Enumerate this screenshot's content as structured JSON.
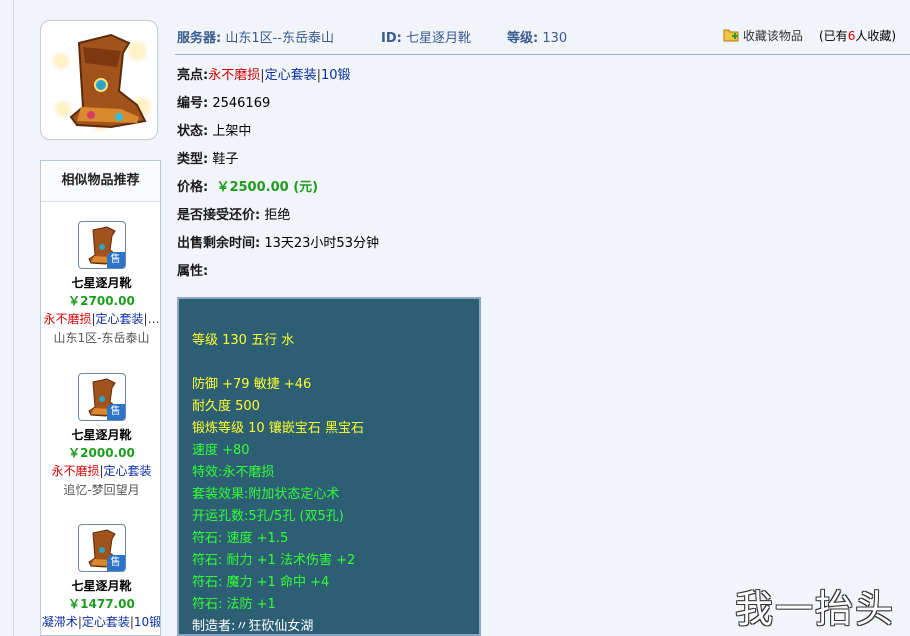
{
  "header": {
    "server_label": "服务器:",
    "server_value": "山东1区--东岳泰山",
    "id_label": "ID:",
    "id_value": "七星逐月靴",
    "level_label": "等级:",
    "level_value": "130",
    "favorite_label": "收藏该物品",
    "fav_pre": "(已有",
    "fav_num": "6",
    "fav_post": "人收藏)"
  },
  "detail": {
    "highlight_label": "亮点:",
    "highlight_tags": [
      "永不磨损",
      "定心套装",
      "10锻"
    ],
    "number_label": "编号:",
    "number_value": "2546169",
    "status_label": "状态:",
    "status_value": "上架中",
    "type_label": "类型:",
    "type_value": "鞋子",
    "price_label": "价格:",
    "price_value": "￥2500.00 (元)",
    "bargain_label": "是否接受还价:",
    "bargain_value": "拒绝",
    "remaining_label": "出售剩余时间:",
    "remaining_value": "13天23小时53分钟",
    "attr_label": "属性:"
  },
  "attributes": [
    {
      "text": "等级 130 五行 水",
      "color": "yellow"
    },
    {
      "text": "",
      "color": "yellow"
    },
    {
      "text": "防御 +79 敏捷 +46",
      "color": "yellow"
    },
    {
      "text": "耐久度 500",
      "color": "yellow"
    },
    {
      "text": "锻炼等级 10 镶嵌宝石 黑宝石",
      "color": "yellow"
    },
    {
      "text": "速度 +80",
      "color": "green"
    },
    {
      "text": "特效:永不磨损",
      "color": "green"
    },
    {
      "text": "套装效果:附加状态定心术",
      "color": "green"
    },
    {
      "text": "开运孔数:5孔/5孔 (双5孔)",
      "color": "green"
    },
    {
      "text": "符石: 速度 +1.5",
      "color": "green"
    },
    {
      "text": "符石: 耐力 +1 法术伤害 +2",
      "color": "green"
    },
    {
      "text": "符石: 魔力 +1 命中 +4",
      "color": "green"
    },
    {
      "text": "符石: 法防 +1",
      "color": "green"
    },
    {
      "text": "制造者:〃狂砍仙女湖",
      "color": "white"
    }
  ],
  "similar": {
    "title": "相似物品推荐",
    "sale_tag": "售",
    "items": [
      {
        "name": "七星逐月靴",
        "price": "￥2700.00",
        "tags": [
          "永不磨损",
          "定心套装",
          "…"
        ],
        "server": "山东1区-东岳泰山"
      },
      {
        "name": "七星逐月靴",
        "price": "￥2000.00",
        "tags": [
          "永不磨损",
          "定心套装"
        ],
        "server": "追忆-梦回望月"
      },
      {
        "name": "七星逐月靴",
        "price": "￥1477.00",
        "tags": [
          "凝滞术",
          "定心套装",
          "10锻"
        ],
        "server": ""
      }
    ]
  },
  "watermark": "我一抬头 就",
  "colors": {
    "attr_bg": "#2c5f73",
    "yellow": "#ffff2e",
    "green": "#33ff33",
    "price_green": "#1d9c1d",
    "tag_red": "#d40000",
    "tag_blue": "#0b2fa0",
    "header_blue": "#3a5b8f"
  }
}
